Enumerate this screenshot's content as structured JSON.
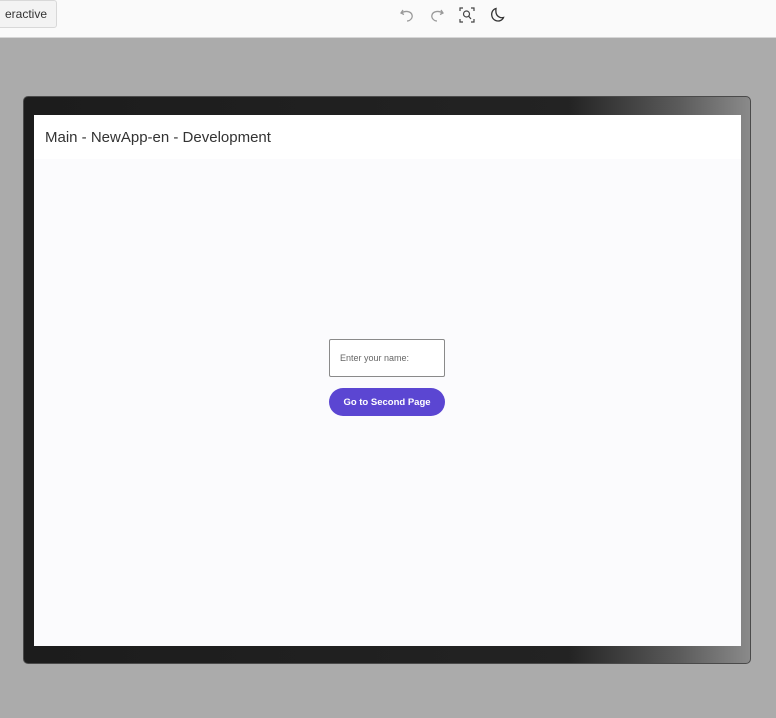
{
  "toolbar": {
    "mode_label": "eractive",
    "icons": {
      "undo": "undo-icon",
      "redo": "redo-icon",
      "inspect": "inspect-icon",
      "theme": "dark-mode-icon"
    }
  },
  "app": {
    "title": "Main - NewApp-en - Development",
    "name_input": {
      "value": "",
      "placeholder": "Enter your name:"
    },
    "go_button_label": "Go to Second Page"
  },
  "colors": {
    "background": "#ababab",
    "toolbar": "#fafafa",
    "frame": "#1f1f1f",
    "screen": "#fbfbfd",
    "accent": "#5b46d2"
  }
}
